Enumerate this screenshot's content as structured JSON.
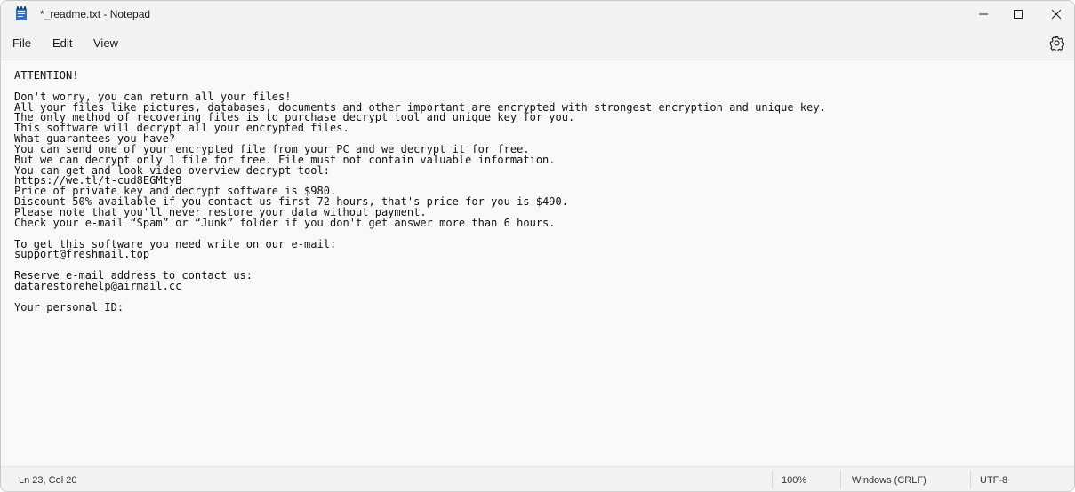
{
  "window": {
    "title": "*_readme.txt - Notepad"
  },
  "menu": {
    "items": [
      "File",
      "Edit",
      "View"
    ]
  },
  "icons": {
    "app": "notepad-icon",
    "minimize": "minimize-icon",
    "maximize": "maximize-icon",
    "close": "close-icon",
    "settings": "gear-icon"
  },
  "editor": {
    "lines": [
      "ATTENTION!",
      "",
      "Don't worry, you can return all your files!",
      "All your files like pictures, databases, documents and other important are encrypted with strongest encryption and unique key.",
      "The only method of recovering files is to purchase decrypt tool and unique key for you.",
      "This software will decrypt all your encrypted files.",
      "What guarantees you have?",
      "You can send one of your encrypted file from your PC and we decrypt it for free.",
      "But we can decrypt only 1 file for free. File must not contain valuable information.",
      "You can get and look video overview decrypt tool:",
      "https://we.tl/t-cud8EGMtyB",
      "Price of private key and decrypt software is $980.",
      "Discount 50% available if you contact us first 72 hours, that's price for you is $490.",
      "Please note that you'll never restore your data without payment.",
      "Check your e-mail “Spam” or “Junk” folder if you don't get answer more than 6 hours.",
      "",
      "To get this software you need write on our e-mail:",
      "support@freshmail.top",
      "",
      "Reserve e-mail address to contact us:",
      "datarestorehelp@airmail.cc",
      "",
      "Your personal ID:"
    ]
  },
  "status": {
    "position": "Ln 23, Col 20",
    "zoom": "100%",
    "line_ending": "Windows (CRLF)",
    "encoding": "UTF-8"
  }
}
